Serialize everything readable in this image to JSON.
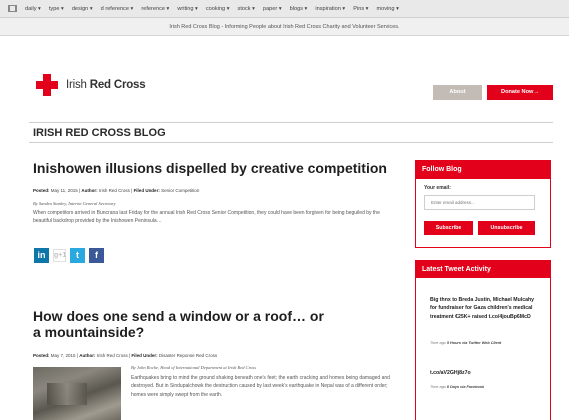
{
  "browser": {
    "bookmarks": [
      "daily ▾",
      "type ▾",
      "design ▾",
      "d reference ▾",
      "reference ▾",
      "writing ▾",
      "cooking ▾",
      "stock ▾",
      "paper ▾",
      "blogs ▾",
      "inspiration ▾",
      "Pins ▾",
      "moving ▾"
    ],
    "window_title": "Irish Red Cross Blog - Informing People about Irish Red Cross Charity and Volunteer Services."
  },
  "header": {
    "logo_text_light": "Irish ",
    "logo_text_bold": "Red Cross",
    "about_label": "About",
    "donate_label": "Donate Now→"
  },
  "blog_title": "IRISH RED CROSS BLOG",
  "posts": [
    {
      "title": "Inishowen illusions dispelled by creative competition",
      "meta_posted_label": "Posted:",
      "meta_date": " May 11, 2015 | ",
      "meta_author_label": "Author:",
      "meta_author": " Irish Red Cross | ",
      "meta_filed_label": "Filed Under:",
      "meta_filed": " Senior Competition",
      "byline": "By Sandra Stanley, Interim General Secretary",
      "excerpt": "When competitors arrived in Buncrana last Friday for the annual Irish Red Cross Senior Competition, they could have been forgiven for being beguiled by the beautiful backdrop provided by the Inishowen Peninsula…"
    },
    {
      "title": "How does one send a window or a roof… or a mountainside?",
      "meta_posted_label": "Posted:",
      "meta_date": " May 7, 2015 | ",
      "meta_author_label": "Author:",
      "meta_author": " Irish Red Cross | ",
      "meta_filed_label": "Filed Under:",
      "meta_filed": " Disaster Reponse Red Cross",
      "byline": "By John Roche, Head of International Department at Irish Red Cross",
      "excerpt": "Earthquakes bring to mind the ground shaking beneath one's feet; the earth cracking and homes being damaged and destroyed. But in Sindupalchowk the destruction caused by last week's earthquake in Nepal was of a different order; homes were simply swept from the earth."
    }
  ],
  "share": {
    "linkedin": "in",
    "googleplus": "g+1",
    "twitter": "t",
    "facebook": "f"
  },
  "sidebar": {
    "follow_title": "Follow Blog",
    "email_label": "Your email:",
    "email_placeholder": "Enter email address...",
    "subscribe_label": "Subscribe",
    "unsubscribe_label": "Unsubscribe",
    "tweets_title": "Latest Tweet Activity",
    "tweets": [
      {
        "text": "Big thnx to Breda Justin, Michael Mulcahy for fundraiser for Gaza children's medical treatment €25K+ raised t.co/4jouBp6McD",
        "time": "Time ago ",
        "time_bold": "5 Hours via Twitter Web Client"
      },
      {
        "text": "t.co/aV2GHj8z7o",
        "time": "Time ago ",
        "time_bold": "8 Days via Facebook"
      }
    ]
  },
  "colors": {
    "brand_red": "#e3001b",
    "about_button": "#c3bcb5"
  }
}
